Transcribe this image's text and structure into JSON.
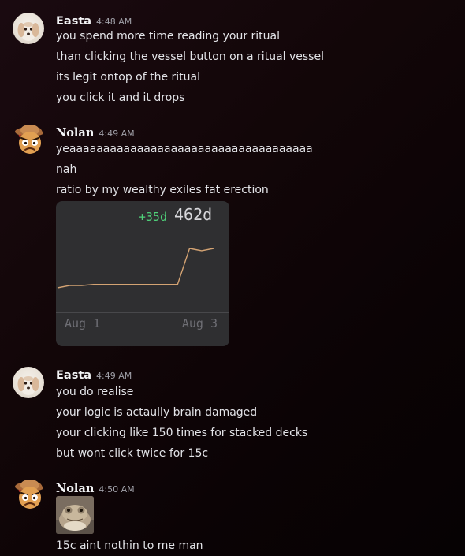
{
  "messages": [
    {
      "author": "Easta",
      "time": "4:48 AM",
      "avatar": "dog-avatar",
      "lines": [
        "you spend more time reading your ritual",
        "than clicking the vessel button on a ritual vessel",
        "its legit ontop of the ritual",
        "you click it and it drops"
      ]
    },
    {
      "author": "Nolan",
      "time": "4:49 AM",
      "avatar": "angry-face-avatar",
      "lines": [
        "yeaaaaaaaaaaaaaaaaaaaaaaaaaaaaaaaaaaaa",
        "nah",
        "ratio by my wealthy exiles fat erection"
      ]
    },
    {
      "author": "Easta",
      "time": "4:49 AM",
      "avatar": "dog-avatar",
      "lines": [
        "you do realise",
        "your logic is actaully brain damaged",
        "your clicking like 150 times for stacked decks",
        "but wont click twice for 15c"
      ]
    },
    {
      "author": "Nolan",
      "time": "4:50 AM",
      "avatar": "angry-face-avatar",
      "lines": [
        "15c aint nothin to me man"
      ]
    }
  ],
  "embed": {
    "change": "+35d",
    "value": "462d",
    "change_color": "#4fd17a",
    "line_color": "#d4a373"
  },
  "chart_data": {
    "type": "line",
    "x_tick_labels": [
      "Aug 1",
      "Aug 3"
    ],
    "series": [
      {
        "values": [
          427,
          429,
          429,
          430,
          430,
          430,
          430,
          430,
          430,
          430,
          430,
          462,
          460,
          462
        ]
      }
    ],
    "grid": false
  },
  "colors": {
    "background": "#120608",
    "text": "#e3e4e8",
    "timestamp": "#a0a0a8"
  }
}
